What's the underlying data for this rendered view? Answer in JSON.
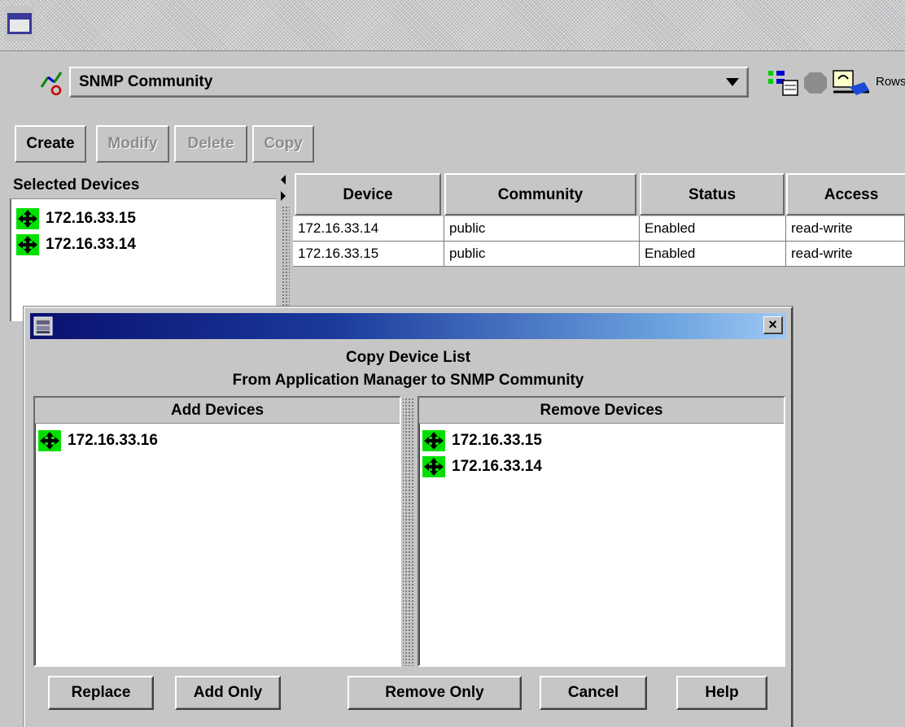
{
  "main": {
    "view_selector": {
      "selected": "SNMP Community"
    },
    "rows_label": "Rows",
    "toolbar": {
      "create": "Create",
      "modify": "Modify",
      "delete": "Delete",
      "copy": "Copy"
    },
    "selected_devices": {
      "title": "Selected Devices",
      "items": [
        "172.16.33.15",
        "172.16.33.14"
      ]
    },
    "table": {
      "columns": [
        "Device",
        "Community",
        "Status",
        "Access"
      ],
      "rows": [
        [
          "172.16.33.14",
          "public",
          "Enabled",
          "read-write"
        ],
        [
          "172.16.33.15",
          "public",
          "Enabled",
          "read-write"
        ]
      ]
    }
  },
  "dialog": {
    "close_glyph": "×",
    "heading_line1": "Copy Device List",
    "heading_line2": "From Application Manager to SNMP Community",
    "add_devices": {
      "title": "Add Devices",
      "items": [
        "172.16.33.16"
      ]
    },
    "remove_devices": {
      "title": "Remove Devices",
      "items": [
        "172.16.33.15",
        "172.16.33.14"
      ]
    },
    "buttons": {
      "replace": "Replace",
      "add_only": "Add Only",
      "remove_only": "Remove Only",
      "cancel": "Cancel",
      "help": "Help"
    }
  },
  "colors": {
    "window_bg": "#c6c6c6",
    "device_icon_green": "#00e000",
    "dialog_title_start": "#0a1070",
    "dialog_title_end": "#a0c8f4"
  },
  "icons": {
    "window": "window-icon",
    "view": "config-view-icon",
    "device": "network-device-icon",
    "dialog": "dialog-app-icon"
  }
}
